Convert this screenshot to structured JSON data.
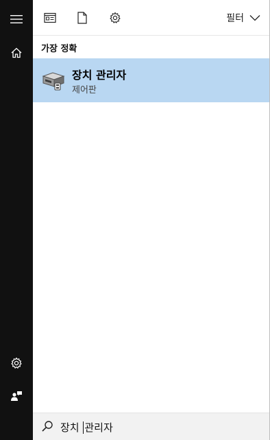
{
  "sidebar": {
    "menu_icon": "hamburger-menu-icon",
    "home_icon": "home-icon",
    "settings_icon": "gear-icon",
    "feedback_icon": "feedback-person-icon"
  },
  "toolbar": {
    "apps_icon": "apps-icon",
    "documents_icon": "document-icon",
    "settings_icon": "gear-icon",
    "filter_label": "필터",
    "filter_chevron": "chevron-down-icon"
  },
  "results": {
    "section_title": "가장 정확",
    "best_match": {
      "title": "장치 관리자",
      "subtitle": "제어판",
      "icon": "device-manager-icon"
    }
  },
  "search": {
    "text_before_caret": "장치 ",
    "text_after_caret": "관리자",
    "icon": "search-icon"
  },
  "colors": {
    "sidebar_bg": "#111111",
    "highlight": "#b9d7f2",
    "search_bg": "#f2f2f2"
  }
}
